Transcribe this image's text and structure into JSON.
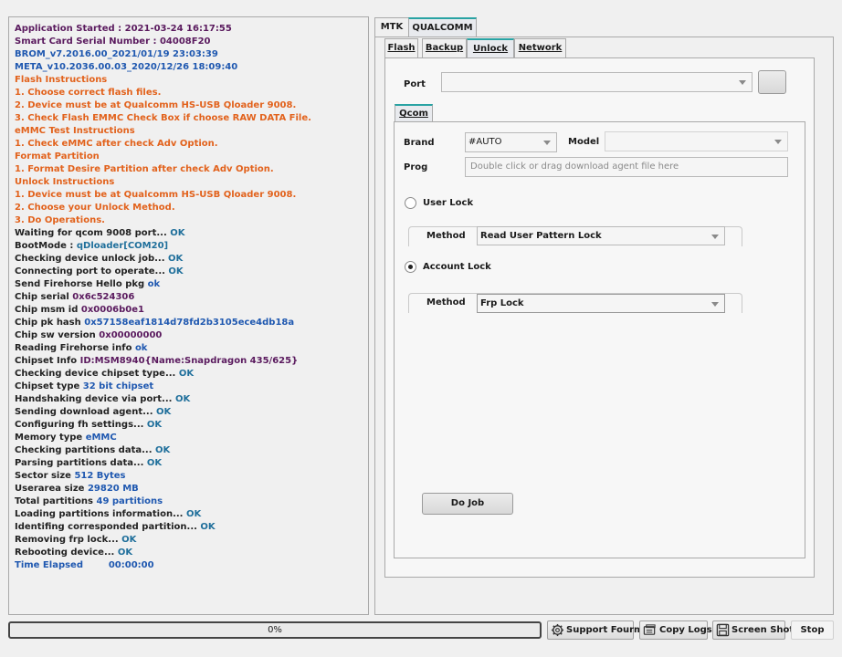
{
  "log": [
    {
      "segments": [
        {
          "t": "Application Started : 2021-03-24 16:17:55",
          "c": "c-purple"
        }
      ]
    },
    {
      "segments": [
        {
          "t": "Smart Card Serial Number : 04008F20",
          "c": "c-purple"
        }
      ]
    },
    {
      "segments": [
        {
          "t": "BROM_v7.2016.00_2021/01/19 23:03:39",
          "c": "c-blue"
        }
      ]
    },
    {
      "segments": [
        {
          "t": "META_v10.2036.00.03_2020/12/26 18:09:40",
          "c": "c-blue"
        }
      ]
    },
    {
      "segments": [
        {
          "t": "Flash Instructions",
          "c": "c-orange"
        }
      ]
    },
    {
      "segments": [
        {
          "t": "1. Choose correct flash files.",
          "c": "c-orange"
        }
      ]
    },
    {
      "segments": [
        {
          "t": "2. Device must be at Qualcomm HS-USB Qloader 9008.",
          "c": "c-orange"
        }
      ]
    },
    {
      "segments": [
        {
          "t": "3. Check Flash EMMC Check Box if choose RAW DATA File.",
          "c": "c-orange"
        }
      ]
    },
    {
      "segments": [
        {
          "t": "eMMC Test Instructions",
          "c": "c-orange"
        }
      ]
    },
    {
      "segments": [
        {
          "t": "1. Check eMMC after check Adv Option.",
          "c": "c-orange"
        }
      ]
    },
    {
      "segments": [
        {
          "t": "Format Partition",
          "c": "c-orange"
        }
      ]
    },
    {
      "segments": [
        {
          "t": "1. Format Desire Partition after check Adv Option.",
          "c": "c-orange"
        }
      ]
    },
    {
      "segments": [
        {
          "t": "Unlock Instructions",
          "c": "c-orange"
        }
      ]
    },
    {
      "segments": [
        {
          "t": "1. Device must be at Qualcomm HS-USB Qloader 9008.",
          "c": "c-orange"
        }
      ]
    },
    {
      "segments": [
        {
          "t": "2. Choose your Unlock Method.",
          "c": "c-orange"
        }
      ]
    },
    {
      "segments": [
        {
          "t": "3. Do Operations.",
          "c": "c-orange"
        }
      ]
    },
    {
      "segments": [
        {
          "t": "Waiting for qcom 9008 port... ",
          "c": "c-dark"
        },
        {
          "t": "OK",
          "c": "c-green"
        }
      ]
    },
    {
      "segments": [
        {
          "t": "BootMode : ",
          "c": "c-dark"
        },
        {
          "t": "qDloader[COM20]",
          "c": "c-green"
        }
      ]
    },
    {
      "segments": [
        {
          "t": "Checking device unlock job... ",
          "c": "c-dark"
        },
        {
          "t": "OK",
          "c": "c-green"
        }
      ]
    },
    {
      "segments": [
        {
          "t": "Connecting port to operate... ",
          "c": "c-dark"
        },
        {
          "t": "OK",
          "c": "c-green"
        }
      ]
    },
    {
      "segments": [
        {
          "t": "Send Firehorse Hello pkg ",
          "c": "c-dark"
        },
        {
          "t": "ok",
          "c": "c-okb"
        }
      ]
    },
    {
      "segments": [
        {
          "t": "Chip serial ",
          "c": "c-dark"
        },
        {
          "t": "0x6c524306",
          "c": "c-purple"
        }
      ]
    },
    {
      "segments": [
        {
          "t": "Chip msm id ",
          "c": "c-dark"
        },
        {
          "t": "0x0006b0e1",
          "c": "c-purple"
        }
      ]
    },
    {
      "segments": [
        {
          "t": "Chip pk hash ",
          "c": "c-dark"
        },
        {
          "t": "0x57158eaf1814d78fd2b3105ece4db18a",
          "c": "c-okb"
        }
      ]
    },
    {
      "segments": [
        {
          "t": "Chip sw version ",
          "c": "c-dark"
        },
        {
          "t": "0x00000000",
          "c": "c-purple"
        }
      ]
    },
    {
      "segments": [
        {
          "t": "Reading Firehorse info ",
          "c": "c-dark"
        },
        {
          "t": "ok",
          "c": "c-okb"
        }
      ]
    },
    {
      "segments": [
        {
          "t": "Chipset Info ",
          "c": "c-dark"
        },
        {
          "t": "ID:MSM8940{Name:Snapdragon 435/625}",
          "c": "c-purple"
        }
      ]
    },
    {
      "segments": [
        {
          "t": "Checking device chipset type... ",
          "c": "c-dark"
        },
        {
          "t": "OK",
          "c": "c-green"
        }
      ]
    },
    {
      "segments": [
        {
          "t": "Chipset type ",
          "c": "c-dark"
        },
        {
          "t": "32 bit chipset",
          "c": "c-okb"
        }
      ]
    },
    {
      "segments": [
        {
          "t": "Handshaking device via port... ",
          "c": "c-dark"
        },
        {
          "t": "OK",
          "c": "c-green"
        }
      ]
    },
    {
      "segments": [
        {
          "t": "Sending download agent... ",
          "c": "c-dark"
        },
        {
          "t": "OK",
          "c": "c-green"
        }
      ]
    },
    {
      "segments": [
        {
          "t": "Configuring fh settings... ",
          "c": "c-dark"
        },
        {
          "t": "OK",
          "c": "c-green"
        }
      ]
    },
    {
      "segments": [
        {
          "t": "Memory type ",
          "c": "c-dark"
        },
        {
          "t": "eMMC",
          "c": "c-okb"
        }
      ]
    },
    {
      "segments": [
        {
          "t": "Checking partitions data... ",
          "c": "c-dark"
        },
        {
          "t": "OK",
          "c": "c-green"
        }
      ]
    },
    {
      "segments": [
        {
          "t": "Parsing partitions data... ",
          "c": "c-dark"
        },
        {
          "t": "OK",
          "c": "c-green"
        }
      ]
    },
    {
      "segments": [
        {
          "t": "Sector size ",
          "c": "c-dark"
        },
        {
          "t": "512 Bytes",
          "c": "c-okb"
        }
      ]
    },
    {
      "segments": [
        {
          "t": "Userarea size ",
          "c": "c-dark"
        },
        {
          "t": "29820 MB",
          "c": "c-okb"
        }
      ]
    },
    {
      "segments": [
        {
          "t": "Total partitions ",
          "c": "c-dark"
        },
        {
          "t": "49 partitions",
          "c": "c-okb"
        }
      ]
    },
    {
      "segments": [
        {
          "t": "Loading partitions information... ",
          "c": "c-dark"
        },
        {
          "t": "OK",
          "c": "c-green"
        }
      ]
    },
    {
      "segments": [
        {
          "t": "Identifing corresponded partition... ",
          "c": "c-dark"
        },
        {
          "t": "OK",
          "c": "c-green"
        }
      ]
    },
    {
      "segments": [
        {
          "t": "Removing frp lock... ",
          "c": "c-dark"
        },
        {
          "t": "OK",
          "c": "c-green"
        }
      ]
    },
    {
      "segments": [
        {
          "t": "Rebooting device... ",
          "c": "c-dark"
        },
        {
          "t": "OK",
          "c": "c-green"
        }
      ]
    },
    {
      "segments": [
        {
          "t": "Time Elapsed        00:00:00",
          "c": "c-blue"
        }
      ]
    }
  ],
  "top_tabs": {
    "mtk": "MTK",
    "qualcomm": "QUALCOMM"
  },
  "sub_tabs": {
    "flash": "Flash",
    "backup": "Backup",
    "unlock": "Unlock",
    "network": "Network"
  },
  "port": {
    "label": "Port",
    "value": ""
  },
  "qcom_tab": "Qcom",
  "brand": {
    "label": "Brand",
    "value": "#AUTO"
  },
  "model": {
    "label": "Model",
    "value": ""
  },
  "prog": {
    "label": "Prog",
    "placeholder": "Double click or drag download agent file here"
  },
  "user_lock": {
    "label": "User Lock",
    "selected": false,
    "method_label": "Method",
    "method_value": "Read User Pattern Lock"
  },
  "account_lock": {
    "label": "Account Lock",
    "selected": true,
    "method_label": "Method",
    "method_value": "Frp Lock"
  },
  "do_job": "Do Job",
  "progress": {
    "percent": 0,
    "text": "0%"
  },
  "bottom_buttons": {
    "support": "Support Fourm",
    "copy_logs": "Copy Logs",
    "screenshot": "Screen Shot",
    "stop": "Stop"
  }
}
